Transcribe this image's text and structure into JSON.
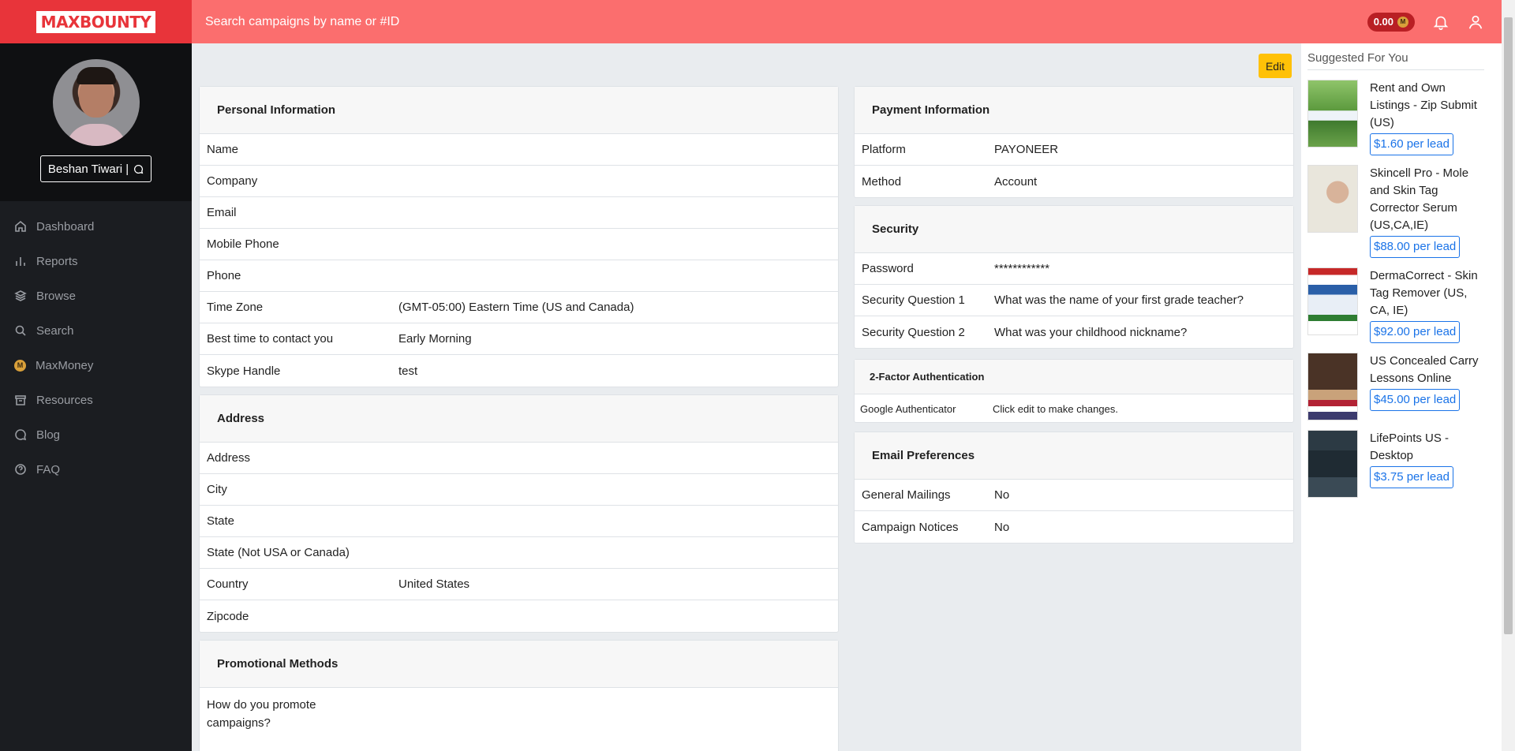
{
  "brand": {
    "logo_text": "MAXBOUNTY",
    "accent": "#e8343a",
    "topbar_color": "#fb6e6e"
  },
  "user": {
    "name": "Beshan Tiwari |"
  },
  "search": {
    "placeholder": "Search campaigns by name or #ID"
  },
  "header": {
    "balance": "0.00"
  },
  "nav": [
    {
      "label": "Dashboard",
      "icon": "home-icon"
    },
    {
      "label": "Reports",
      "icon": "bar-chart-icon"
    },
    {
      "label": "Browse",
      "icon": "layers-icon"
    },
    {
      "label": "Search",
      "icon": "search-icon"
    },
    {
      "label": "MaxMoney",
      "icon": "coin-icon"
    },
    {
      "label": "Resources",
      "icon": "archive-icon"
    },
    {
      "label": "Blog",
      "icon": "chat-icon"
    },
    {
      "label": "FAQ",
      "icon": "help-icon"
    }
  ],
  "main": {
    "edit_label": "Edit",
    "personal": {
      "title": "Personal Information",
      "rows": [
        {
          "k": "Name",
          "v": ""
        },
        {
          "k": "Company",
          "v": ""
        },
        {
          "k": "Email",
          "v": ""
        },
        {
          "k": "Mobile Phone",
          "v": ""
        },
        {
          "k": "Phone",
          "v": ""
        },
        {
          "k": "Time Zone",
          "v": "(GMT-05:00) Eastern Time (US and Canada)"
        },
        {
          "k": "Best time to contact you",
          "v": "Early Morning"
        },
        {
          "k": "Skype Handle",
          "v": "test"
        }
      ]
    },
    "address": {
      "title": "Address",
      "rows": [
        {
          "k": "Address",
          "v": ""
        },
        {
          "k": "City",
          "v": ""
        },
        {
          "k": "State",
          "v": ""
        },
        {
          "k": "State (Not USA or Canada)",
          "v": ""
        },
        {
          "k": "Country",
          "v": "United States"
        },
        {
          "k": "Zipcode",
          "v": ""
        }
      ]
    },
    "promo": {
      "title": "Promotional Methods",
      "question": "How do you promote campaigns?"
    },
    "payment": {
      "title": "Payment Information",
      "rows": [
        {
          "k": "Platform",
          "v": "PAYONEER"
        },
        {
          "k": "Method",
          "v": "Account"
        }
      ]
    },
    "security": {
      "title": "Security",
      "rows": [
        {
          "k": "Password",
          "v": "************"
        },
        {
          "k": "Security Question 1",
          "v": "What was the name of your first grade teacher?"
        },
        {
          "k": "Security Question 2",
          "v": "What was your childhood nickname?"
        }
      ]
    },
    "twofa": {
      "title": "2-Factor Authentication",
      "rows": [
        {
          "k": "Google Authenticator",
          "v": "Click edit to make changes."
        }
      ]
    },
    "email_prefs": {
      "title": "Email Preferences",
      "rows": [
        {
          "k": "General Mailings",
          "v": "No"
        },
        {
          "k": "Campaign Notices",
          "v": "No"
        }
      ]
    }
  },
  "suggested": {
    "title": "Suggested For You",
    "offers": [
      {
        "name": "Rent and Own Listings - Zip Submit (US)",
        "price": "$1.60 per lead",
        "thumb_color": "#5c9a3e"
      },
      {
        "name": "Skincell Pro - Mole and Skin Tag Corrector Serum (US,CA,IE)",
        "price": "$88.00 per lead",
        "thumb_color": "#e9e6dc"
      },
      {
        "name": "DermaCorrect - Skin Tag Remover (US, CA, IE)",
        "price": "$92.00 per lead",
        "thumb_color": "#2a5fa8"
      },
      {
        "name": "US Concealed Carry Lessons Online",
        "price": "$45.00 per lead",
        "thumb_color": "#5b4032"
      },
      {
        "name": "LifePoints US - Desktop",
        "price": "$3.75 per lead",
        "thumb_color": "#1f2b33"
      }
    ]
  }
}
